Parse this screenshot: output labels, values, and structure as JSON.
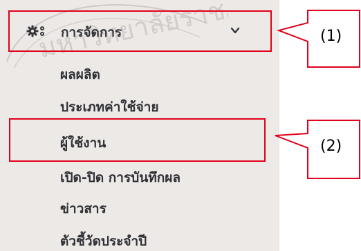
{
  "menu": {
    "title": "การจัดการ",
    "icon": "gears-icon",
    "expand_icon": "chevron-down-icon",
    "items": [
      {
        "label": "ผลผลิต"
      },
      {
        "label": "ประเภทค่าใช้จ่าย"
      },
      {
        "label": "ผู้ใช้งาน"
      },
      {
        "label": "เปิด-ปิด การบันทึกผล"
      },
      {
        "label": "ข่าวสาร"
      },
      {
        "label": "ตัวชี้วัดประจำปี"
      }
    ]
  },
  "annotations": [
    {
      "label": "(1)",
      "color": "#e0001b"
    },
    {
      "label": "(2)",
      "color": "#e0001b"
    }
  ],
  "watermark": {
    "text": "มหาวิทยาลัยราชภัฏ",
    "color": "#c9c4c1"
  }
}
